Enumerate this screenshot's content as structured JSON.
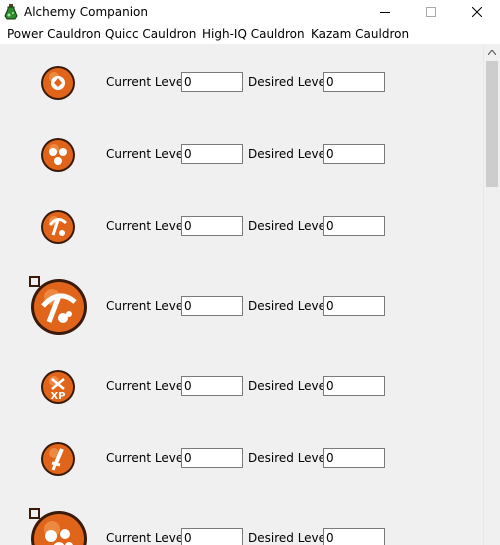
{
  "window": {
    "title": "Alchemy Companion",
    "icon": "alchemy-flask-icon"
  },
  "menu": {
    "items": [
      {
        "label": "Power Cauldron"
      },
      {
        "label": "Quicc Cauldron"
      },
      {
        "label": "High-IQ Cauldron"
      },
      {
        "label": "Kazam Cauldron"
      }
    ]
  },
  "bubbles": [
    {
      "icon": "bubble-roid-ragin-icon",
      "current_label": "Current Level:",
      "current_value": "0",
      "desired_label": "Desired Level:",
      "desired_value": "0"
    },
    {
      "icon": "bubble-warriors-rule-icon",
      "current_label": "Current Level:",
      "current_value": "0",
      "desired_label": "Desired Level:",
      "desired_value": "0"
    },
    {
      "icon": "bubble-hearty-diggy-icon",
      "current_label": "Current Level:",
      "current_value": "0",
      "desired_label": "Desired Level:",
      "desired_value": "0"
    },
    {
      "icon": "bubble-wyoming-blood-icon",
      "current_label": "Current Level:",
      "current_value": "0",
      "desired_label": "Desired Level:",
      "desired_value": "0"
    },
    {
      "icon": "bubble-reely-warrior-xp-icon",
      "current_label": "Current Level:",
      "current_value": "0",
      "desired_label": "Desired Level:",
      "desired_value": "0"
    },
    {
      "icon": "bubble-warriors-sword-icon",
      "current_label": "Current Level:",
      "current_value": "0",
      "desired_label": "Desired Level:",
      "desired_value": "0"
    },
    {
      "icon": "bubble-big-meaty-claws-icon",
      "current_label": "Current Level:",
      "current_value": "0",
      "desired_label": "Desired Level:",
      "desired_value": "0"
    }
  ],
  "colors": {
    "bubble_orange": "#e0651a",
    "bubble_dark": "#3a1a08",
    "bubble_highlight": "#f5a25a"
  }
}
